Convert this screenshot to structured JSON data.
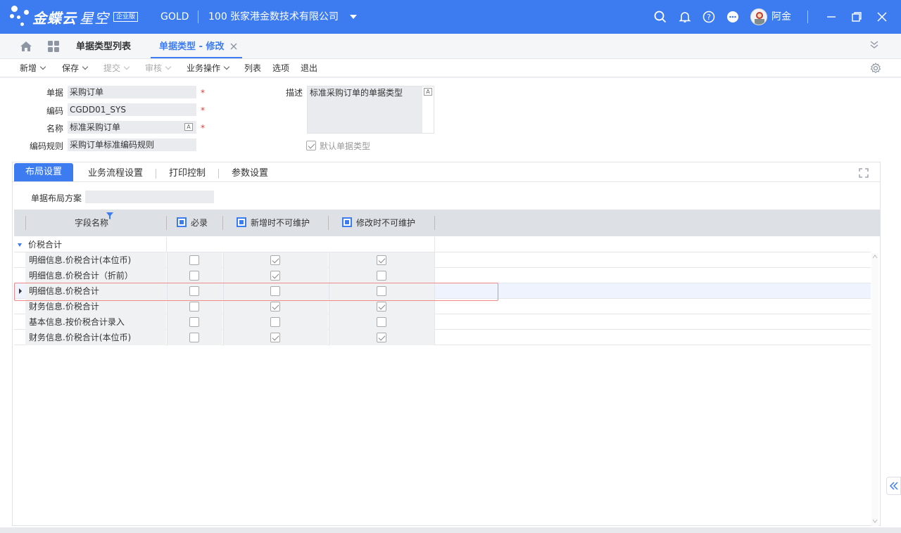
{
  "app": {
    "brand": "金蝶云",
    "product": "星空",
    "edition": "企业版",
    "data_center": "GOLD",
    "org_code": "100",
    "org_name": "张家港金数技术有限公司",
    "user": "阿金",
    "accent": "#3d7cf0"
  },
  "tabs": {
    "list_tab": "单据类型列表",
    "edit_tab": "单据类型 - 修改"
  },
  "toolbar": {
    "new": "新增",
    "save": "保存",
    "submit": "提交",
    "audit": "审核",
    "biz_ops": "业务操作",
    "list": "列表",
    "options": "选项",
    "exit": "退出"
  },
  "form": {
    "bill_label": "单据",
    "bill_value": "采购订单",
    "code_label": "编码",
    "code_value": "CGDD01_SYS",
    "name_label": "名称",
    "name_value": "标准采购订单",
    "rule_label": "编码规则",
    "rule_value": "采购订单标准编码规则",
    "desc_label": "描述",
    "desc_value": "标准采购订单的单据类型",
    "default_label": "默认单据类型",
    "default_checked": true,
    "required_mark": "*"
  },
  "panel": {
    "tabs": [
      "布局设置",
      "业务流程设置",
      "打印控制",
      "参数设置"
    ],
    "active_tab": 0,
    "layout_scheme_label": "单据布局方案",
    "layout_scheme_value": ""
  },
  "grid": {
    "headers": {
      "field_name": "字段名称",
      "required": "必录",
      "no_edit_on_add": "新增时不可维护",
      "no_edit_on_modify": "修改时不可维护"
    },
    "group": "价税合计",
    "rows": [
      {
        "name": "明细信息.价税合计(本位币)",
        "required": false,
        "no_add": true,
        "no_modify": true
      },
      {
        "name": "明细信息.价税合计（折前）",
        "required": false,
        "no_add": true,
        "no_modify": false
      },
      {
        "name": "明细信息.价税合计",
        "required": false,
        "no_add": false,
        "no_modify": false
      },
      {
        "name": "财务信息.价税合计",
        "required": false,
        "no_add": true,
        "no_modify": true
      },
      {
        "name": "基本信息.按价税合计录入",
        "required": false,
        "no_add": false,
        "no_modify": false
      },
      {
        "name": "财务信息.价税合计(本位币)",
        "required": false,
        "no_add": true,
        "no_modify": true
      }
    ],
    "selected_row": 2
  }
}
